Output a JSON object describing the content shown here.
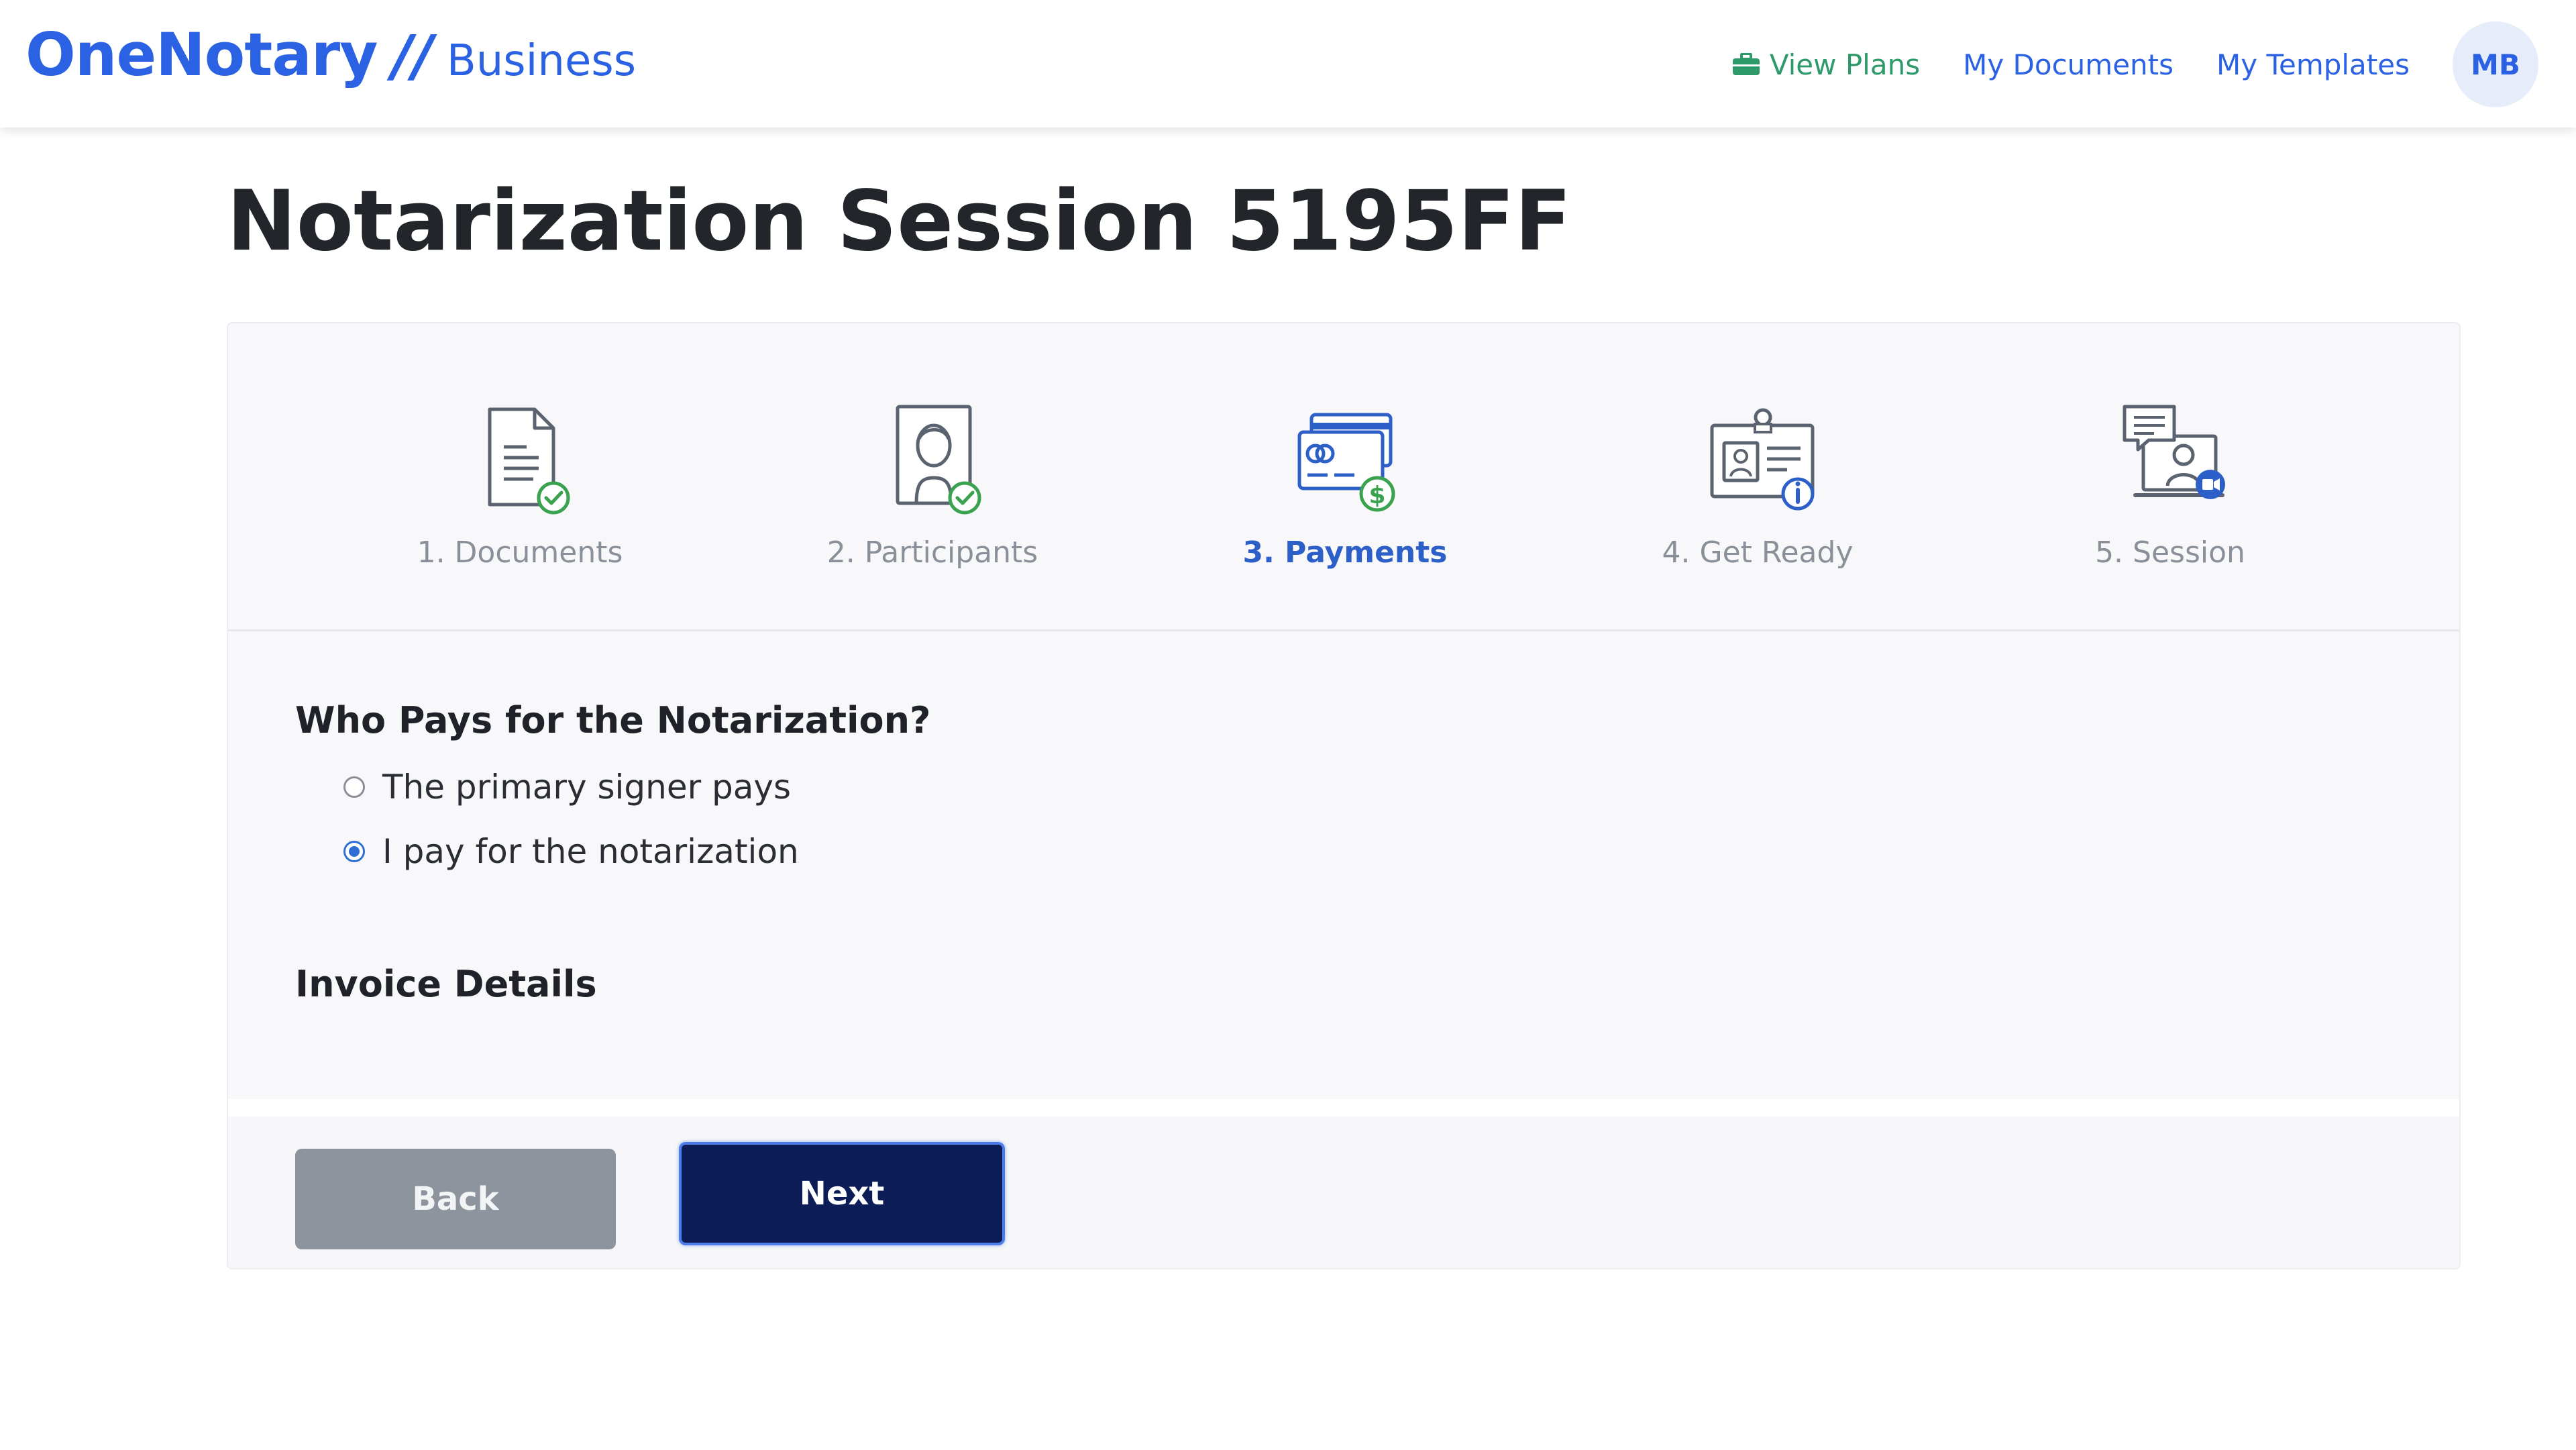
{
  "header": {
    "brand_name": "OneNotary",
    "brand_separator": "//",
    "brand_sub": "Business",
    "nav": {
      "view_plans": "View Plans",
      "my_documents": "My Documents",
      "my_templates": "My Templates"
    },
    "avatar_initials": "MB",
    "colors": {
      "brand": "#2b62e3",
      "plans": "#2e9a6a"
    }
  },
  "page": {
    "title": "Notarization Session 5195FF"
  },
  "steps": [
    {
      "label": "1. Documents",
      "icon": "document-check-icon",
      "state": "done"
    },
    {
      "label": "2. Participants",
      "icon": "person-check-icon",
      "state": "done"
    },
    {
      "label": "3. Payments",
      "icon": "credit-card-dollar-icon",
      "state": "active"
    },
    {
      "label": "4. Get Ready",
      "icon": "id-card-info-icon",
      "state": "pending"
    },
    {
      "label": "5. Session",
      "icon": "video-chat-icon",
      "state": "pending"
    }
  ],
  "payment": {
    "question": "Who Pays for the Notarization?",
    "options": [
      {
        "label": "The primary signer pays",
        "selected": false
      },
      {
        "label": "I pay for the notarization",
        "selected": true
      }
    ],
    "invoice_title": "Invoice Details"
  },
  "footer": {
    "back_label": "Back",
    "next_label": "Next"
  }
}
